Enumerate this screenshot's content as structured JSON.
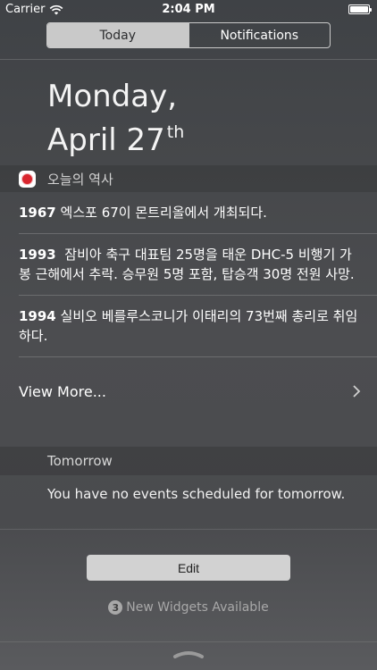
{
  "status_bar": {
    "carrier": "Carrier",
    "time": "2:04 PM",
    "wifi_icon": "wifi-icon",
    "battery_icon": "battery-icon"
  },
  "tabs": [
    {
      "label": "Today",
      "active": true
    },
    {
      "label": "Notifications",
      "active": false
    }
  ],
  "date": {
    "line1": "Monday,",
    "line2": "April 27",
    "suffix": "th"
  },
  "widget": {
    "title": "오늘의 역사",
    "icon": "app-icon",
    "events": [
      {
        "year": "1967",
        "text": "엑스포 67이 몬트리올에서 개최되다."
      },
      {
        "year": "1993",
        "text": "잠비아 축구 대표팀 25명을 태운 DHC-5 비행기 가봉 근해에서 추락. 승무원 5명 포함, 탑승객 30명 전원 사망."
      },
      {
        "year": "1994",
        "text": "실비오 베를루스코니가 이태리의 73번째 총리로 취임하다."
      }
    ],
    "view_more": "View More...",
    "chevron_icon": "chevron-right-icon"
  },
  "tomorrow": {
    "title": "Tomorrow",
    "empty_text": "You have no events scheduled for tomorrow."
  },
  "edit_label": "Edit",
  "new_widgets": {
    "count": "3",
    "text": "New Widgets Available"
  },
  "colors": {
    "accent": "#c9c9c9",
    "background": "#46484b"
  }
}
